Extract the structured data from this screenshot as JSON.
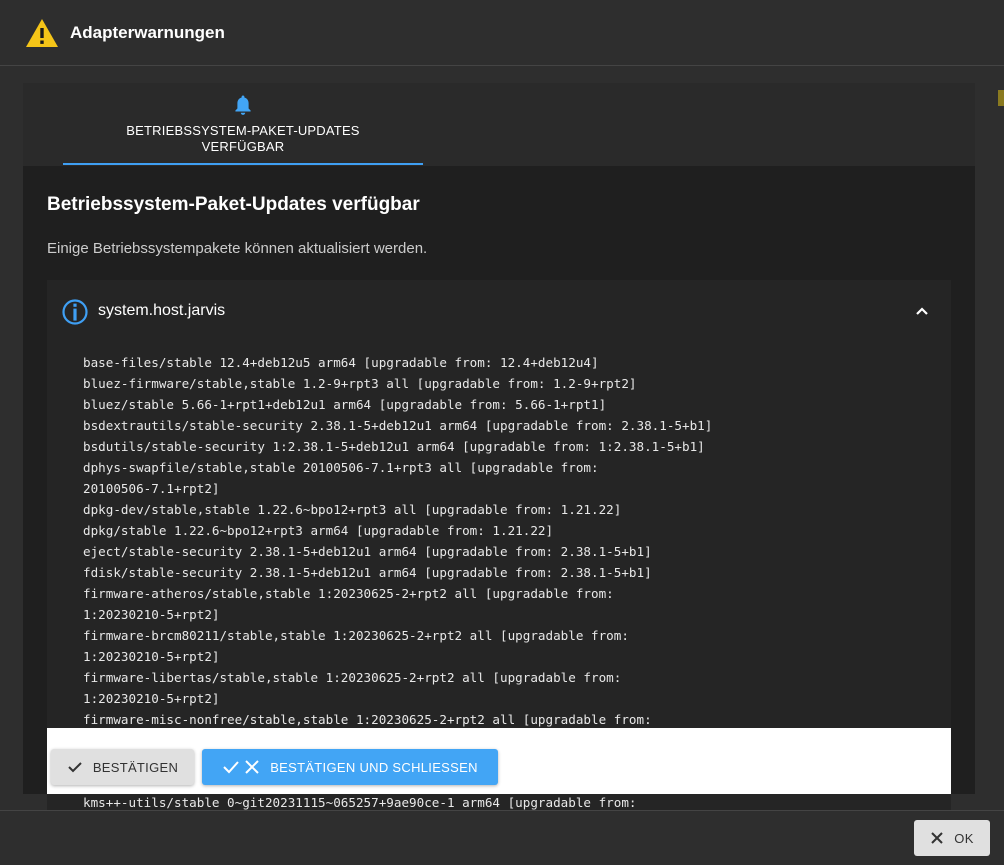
{
  "dialog": {
    "title": "Adapterwarnungen",
    "icon": "warning-triangle-icon"
  },
  "tabs": [
    {
      "label": "BETRIEBSSYSTEM-PAKET-UPDATES\nVERFÜGBAR",
      "icon": "bell-icon",
      "active": true
    }
  ],
  "section": {
    "title": "Betriebssystem-Paket-Updates verfügbar",
    "description": "Einige Betriebssystempakete können aktualisiert werden."
  },
  "host": {
    "name": "system.host.jarvis",
    "icon": "info-circle-icon",
    "expanded": true,
    "packages": [
      "base-files/stable 12.4+deb12u5 arm64 [upgradable from: 12.4+deb12u4]",
      "bluez-firmware/stable,stable 1.2-9+rpt3 all [upgradable from: 1.2-9+rpt2]",
      "bluez/stable 5.66-1+rpt1+deb12u1 arm64 [upgradable from: 5.66-1+rpt1]",
      "bsdextrautils/stable-security 2.38.1-5+deb12u1 arm64 [upgradable from: 2.38.1-5+b1]",
      "bsdutils/stable-security 1:2.38.1-5+deb12u1 arm64 [upgradable from: 1:2.38.1-5+b1]",
      "dphys-swapfile/stable,stable 20100506-7.1+rpt3 all [upgradable from:\n20100506-7.1+rpt2]",
      "dpkg-dev/stable,stable 1.22.6~bpo12+rpt3 all [upgradable from: 1.21.22]",
      "dpkg/stable 1.22.6~bpo12+rpt3 arm64 [upgradable from: 1.21.22]",
      "eject/stable-security 2.38.1-5+deb12u1 arm64 [upgradable from: 2.38.1-5+b1]",
      "fdisk/stable-security 2.38.1-5+deb12u1 arm64 [upgradable from: 2.38.1-5+b1]",
      "firmware-atheros/stable,stable 1:20230625-2+rpt2 all [upgradable from:\n1:20230210-5+rpt2]",
      "firmware-brcm80211/stable,stable 1:20230625-2+rpt2 all [upgradable from:\n1:20230210-5+rpt2]",
      "firmware-libertas/stable,stable 1:20230625-2+rpt2 all [upgradable from:\n1:20230210-5+rpt2]",
      "firmware-misc-nonfree/stable,stable 1:20230625-2+rpt2 all [upgradable from:"
    ],
    "last_visible_line": "kms++-utils/stable 0~git20231115~065257+9ae90ce-1 arm64 [upgradable from:"
  },
  "actions": {
    "confirm_label": "BESTÄTIGEN",
    "confirm_close_label": "BESTÄTIGEN UND SCHLIESSEN",
    "ok_label": "OK"
  },
  "colors": {
    "accent": "#42a5f5",
    "warning": "#f5c518",
    "background": "#2e2e2e"
  }
}
